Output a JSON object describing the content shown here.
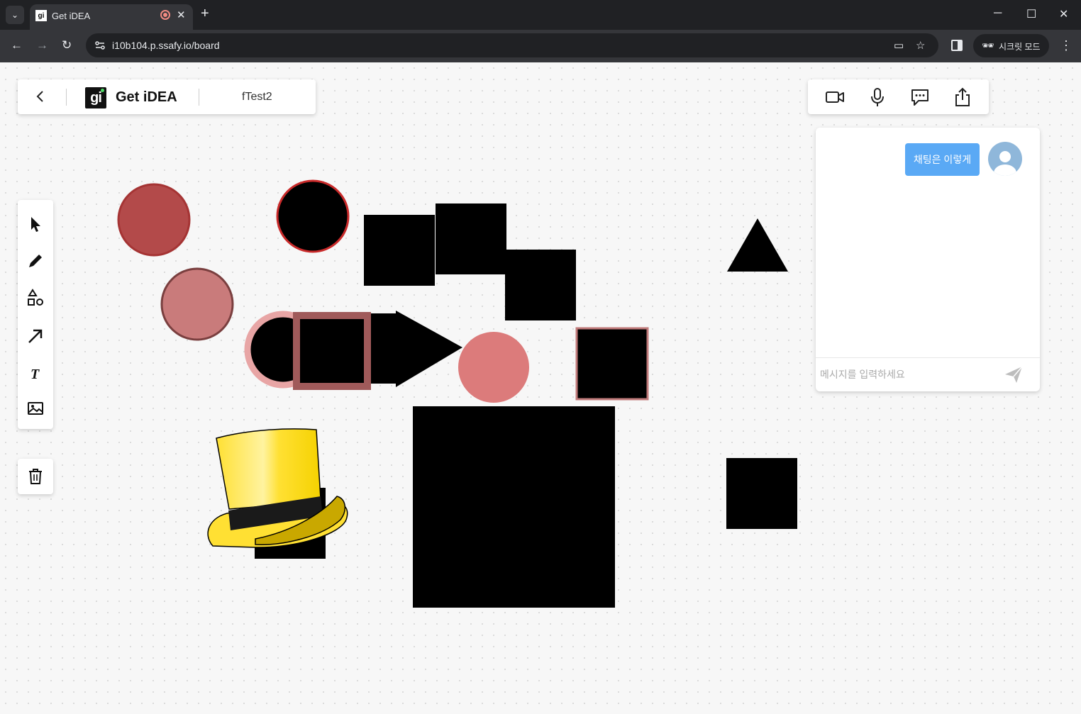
{
  "browser": {
    "tab_title": "Get iDEA",
    "tab_favicon": "gi",
    "url": "i10b104.p.ssafy.io/board",
    "incognito_label": "시크릿 모드"
  },
  "header": {
    "app_name": "Get iDEA",
    "logo_text": "gi",
    "board_name": "fTest2"
  },
  "media_controls": [
    "video-camera-icon",
    "microphone-icon",
    "chat-bubble-icon",
    "share-icon"
  ],
  "tools": [
    "select-cursor-icon",
    "pen-icon",
    "shapes-icon",
    "arrow-icon",
    "text-icon",
    "image-icon"
  ],
  "chat": {
    "messages": [
      {
        "text": "채팅은 이렇게"
      }
    ],
    "input_placeholder": "메시지를 입력하세요"
  },
  "colors": {
    "accent": "#5aa9f5",
    "shape_red": "#b34a4a",
    "shape_rose": "#c97b7b",
    "shape_pink": "#dc7b7b",
    "hat_yellow": "#ffe033"
  }
}
